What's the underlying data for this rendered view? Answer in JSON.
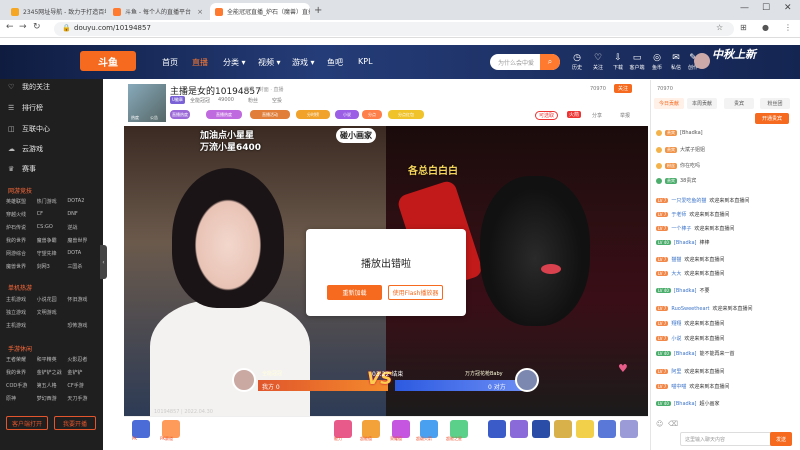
{
  "browser": {
    "tabs": [
      {
        "label": "2345网址导航 - 致力于打造百年",
        "active": false
      },
      {
        "label": "斗鱼 - 每个人的直播平台",
        "active": false
      },
      {
        "label": "全能冠冠直播_炉石（魔兽）直播",
        "active": true
      }
    ],
    "url": "douyu.com/10194857"
  },
  "header": {
    "logo": "斗鱼",
    "nav": [
      "首页",
      "直播",
      "分类",
      "视频",
      "游戏",
      "鱼吧",
      "KPL"
    ],
    "search_placeholder": "为什么会中爱",
    "icons": [
      "历史",
      "关注",
      "下载",
      "客户端",
      "鱼币",
      "私信",
      "创作"
    ],
    "promo": "中秋上新"
  },
  "sidebar": {
    "items": [
      "我的关注",
      "排行榜",
      "互联中心",
      "云游戏",
      "赛事"
    ],
    "sections": [
      {
        "title": "网游竞技",
        "more": "全部",
        "tags": [
          "英雄联盟",
          "热门游戏",
          "DOTA2",
          "穿越火线",
          "CF",
          "DNF",
          "炉石传说",
          "CS:GO",
          "逆战",
          "我的世界",
          "魔兽争霸",
          "魔兽世界",
          "网游综合",
          "守望先锋",
          "DOTA",
          "魔兽世界",
          "剑网3",
          "三国杀"
        ]
      },
      {
        "title": "单机热游",
        "more": "全部",
        "tags": [
          "主机游戏",
          "小说花园",
          "怀旧游戏",
          "独立游戏",
          "文明游戏",
          "",
          "主机游戏",
          "",
          "恐怖游戏"
        ]
      },
      {
        "title": "手游休闲",
        "more": "全部",
        "tags": [
          "王者荣耀",
          "和平精英",
          "火影忍者",
          "我的世界",
          "金铲铲之战",
          "金铲铲",
          "COD手游",
          "第五人格",
          "CF手游",
          "原神",
          "梦幻西游",
          "天刀手游"
        ]
      }
    ],
    "buttons": [
      "客户端打开",
      "我要开播"
    ]
  },
  "room": {
    "thumb_labels": [
      "热度",
      "公告"
    ],
    "title": "主播是女的10194857",
    "sub": "举报 · 封面 · 直播",
    "badges": [
      "U徽章",
      "直播热度",
      "上周榜 3"
    ],
    "meta": [
      "全能冠冠",
      "49000",
      "粉丝",
      "空投"
    ],
    "pills": [
      "直播热度",
      "直播活动",
      "分时榜",
      "小说",
      "分点",
      "分点红包"
    ],
    "follow_count": "70970",
    "follow_label": "关注",
    "pk_label": "可选取",
    "pk_tag": "火箭",
    "share": "分享",
    "report": "举报"
  },
  "video": {
    "overlay_left_1": "加油点小星星",
    "overlay_left_2": "万流小星6400",
    "overlay_center": "碰小画家",
    "overlay_right": "各总白白白",
    "error_title": "播放出错啦",
    "error_btn_retry": "重新加载",
    "error_btn_flash": "使用Flash播放器",
    "pk": {
      "left_name": "全能冠冠",
      "left_score": "我方 0",
      "vs": "VS",
      "timer": "03:22 结束",
      "right_name": "万方冠花枪Baby",
      "right_score": "0 对方"
    },
    "footer": "10194857 | 2022.04.30"
  },
  "gifts": {
    "labels": [
      "PK",
      "PK赛道",
      "能力",
      "超能值",
      "荣耀值",
      "超级火箭",
      "超能之星",
      "超能值",
      "荣耀值"
    ]
  },
  "chat": {
    "op": "70970",
    "tabs": [
      "今日贡献",
      "本周贡献",
      "贵宾",
      "粉丝团"
    ],
    "tab_extra": "粉丝",
    "top_button": "开通贵宾",
    "ranks": [
      {
        "name": "[Bhadka]",
        "tag": "贵宾"
      },
      {
        "name": "大斌子姐姐",
        "tag": "贵宾"
      },
      {
        "name": "你在吃吗",
        "tag": "粉丝"
      },
      {
        "name": "38贵宾",
        "tag": "贵宾"
      }
    ],
    "messages": [
      {
        "lvl": "LV 7",
        "color": "#f2894a",
        "user": "一只爱吃鱼的猫",
        "text": "欢迎来到本直播间"
      },
      {
        "lvl": "LV 7",
        "color": "#f2894a",
        "user": "于老师",
        "text": "欢迎来到本直播间"
      },
      {
        "lvl": "LV 7",
        "color": "#f2894a",
        "user": "一个棒子",
        "text": "欢迎来到本直播间"
      },
      {
        "lvl": "LV 40",
        "color": "#4cae6c",
        "user": "[Bhadka]",
        "text": "棒棒"
      },
      {
        "lvl": "LV 7",
        "color": "#f2894a",
        "user": "猫猫",
        "text": "欢迎来到本直播间"
      },
      {
        "lvl": "LV 7",
        "color": "#f2894a",
        "user": "大大",
        "text": "欢迎来到本直播间"
      },
      {
        "lvl": "LV 40",
        "color": "#4cae6c",
        "user": "[Bhadka]",
        "text": "不要"
      },
      {
        "lvl": "LV 7",
        "color": "#f2894a",
        "user": "RuoSweetheart",
        "text": "欢迎来到本直播间"
      },
      {
        "lvl": "LV 7",
        "color": "#f2894a",
        "user": "翔翔",
        "text": "欢迎来到本直播间"
      },
      {
        "lvl": "LV 7",
        "color": "#f2894a",
        "user": "小说",
        "text": "欢迎来到本直播间"
      },
      {
        "lvl": "LV 40",
        "color": "#4cae6c",
        "user": "[Bhadka]",
        "text": "能不能再来一首"
      },
      {
        "lvl": "LV 7",
        "color": "#f2894a",
        "user": "阿里",
        "text": "欢迎来到本直播间"
      },
      {
        "lvl": "LV 7",
        "color": "#f2894a",
        "user": "喵中喵",
        "text": "欢迎来到本直播间"
      },
      {
        "lvl": "LV 40",
        "color": "#4cae6c",
        "user": "[Bhadka]",
        "text": "超小画家"
      }
    ],
    "input_placeholder": "这里输入聊天内容",
    "send": "发送"
  }
}
